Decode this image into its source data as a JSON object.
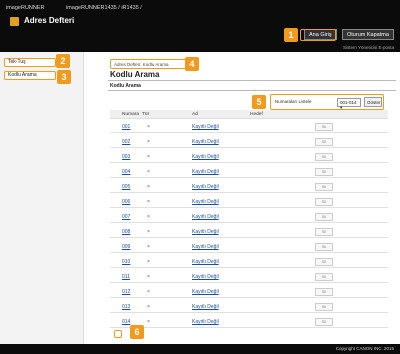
{
  "header": {
    "brand": "imageRUNNER",
    "model": "imageRUNNER1435 / iR1435 /",
    "app_title": "Adres Defteri",
    "home_button": "Ana Giriş",
    "logout_button": "Oturum Kapatma",
    "system_mail": "Sistem Yöneticisi E-posta"
  },
  "sidebar": {
    "items": [
      {
        "label": "Tek-Tuş"
      },
      {
        "label": "Kodlu Arama"
      }
    ]
  },
  "main": {
    "breadcrumb": "Adres Defteri: Kodlu Arama",
    "title": "Kodlu Arama",
    "section": "Kodlu Arama",
    "controls": {
      "label": "Numaraları Listele",
      "selected": "001-014",
      "show_button": "Göster"
    },
    "table": {
      "headers": [
        "Numara",
        "Tür",
        "Ad",
        "Hedef"
      ],
      "rows": [
        {
          "num": "001",
          "type": "×",
          "name": "Kayıtlı Değil",
          "action": "Sil"
        },
        {
          "num": "002",
          "type": "×",
          "name": "Kayıtlı Değil",
          "action": "Sil"
        },
        {
          "num": "003",
          "type": "×",
          "name": "Kayıtlı Değil",
          "action": "Sil"
        },
        {
          "num": "004",
          "type": "×",
          "name": "Kayıtlı Değil",
          "action": "Sil"
        },
        {
          "num": "005",
          "type": "×",
          "name": "Kayıtlı Değil",
          "action": "Sil"
        },
        {
          "num": "006",
          "type": "×",
          "name": "Kayıtlı Değil",
          "action": "Sil"
        },
        {
          "num": "007",
          "type": "×",
          "name": "Kayıtlı Değil",
          "action": "Sil"
        },
        {
          "num": "008",
          "type": "×",
          "name": "Kayıtlı Değil",
          "action": "Sil"
        },
        {
          "num": "009",
          "type": "×",
          "name": "Kayıtlı Değil",
          "action": "Sil"
        },
        {
          "num": "010",
          "type": "×",
          "name": "Kayıtlı Değil",
          "action": "Sil"
        },
        {
          "num": "011",
          "type": "×",
          "name": "Kayıtlı Değil",
          "action": "Sil"
        },
        {
          "num": "012",
          "type": "×",
          "name": "Kayıtlı Değil",
          "action": "Sil"
        },
        {
          "num": "013",
          "type": "×",
          "name": "Kayıtlı Değil",
          "action": "Sil"
        },
        {
          "num": "014",
          "type": "×",
          "name": "Kayıtlı Değil",
          "action": "Sil"
        }
      ]
    }
  },
  "footer": {
    "copyright": "Copyright CANON INC. 2015"
  },
  "annotations": {
    "labels": [
      "1",
      "2",
      "3",
      "4",
      "5",
      "6"
    ]
  },
  "colors": {
    "accent": "#f19a1c",
    "header_bg": "#0b0b0b",
    "link": "#1a4e9e"
  }
}
